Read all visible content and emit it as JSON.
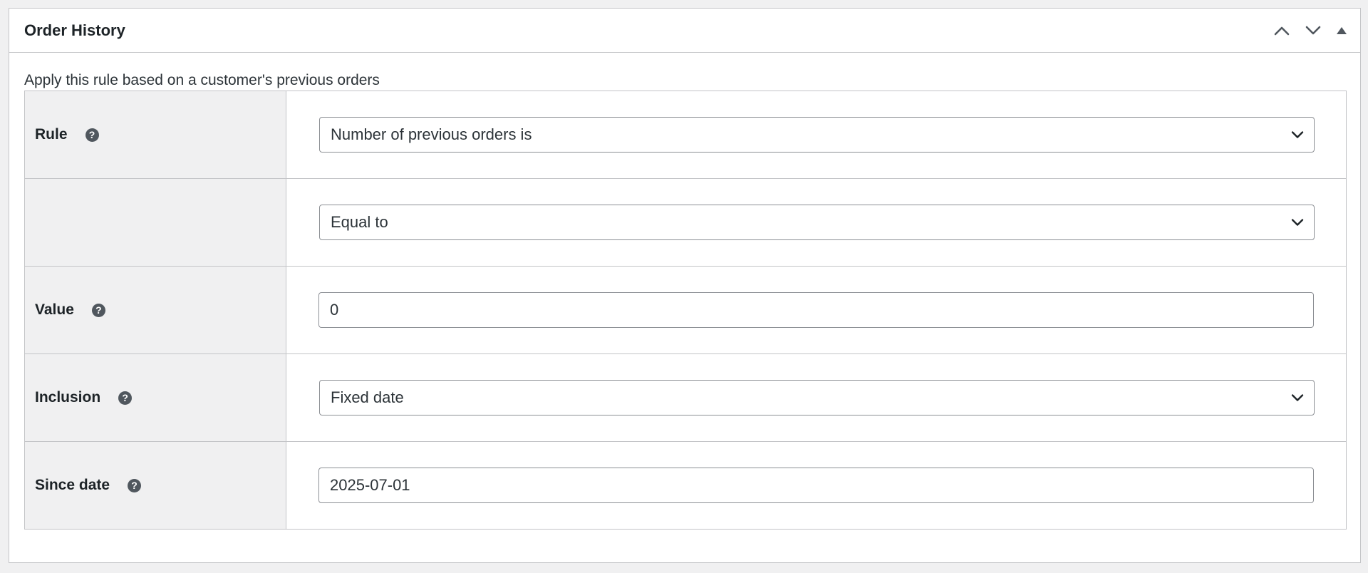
{
  "panel": {
    "title": "Order History",
    "controls": {
      "move_up_icon": "chevron-up-icon",
      "move_down_icon": "chevron-down-icon",
      "toggle_icon": "triangle-up-icon"
    }
  },
  "description": "Apply this rule based on a customer's previous orders",
  "fields": {
    "rule": {
      "label": "Rule",
      "help_icon": "?",
      "selected": "Number of previous orders is"
    },
    "comparison": {
      "label": "",
      "selected": "Equal to"
    },
    "value": {
      "label": "Value",
      "help_icon": "?",
      "value": "0"
    },
    "inclusion": {
      "label": "Inclusion",
      "help_icon": "?",
      "selected": "Fixed date"
    },
    "since_date": {
      "label": "Since date",
      "help_icon": "?",
      "value": "2025-07-01"
    }
  },
  "colors": {
    "background": "#f0f0f1",
    "border": "#c3c4c7",
    "input_border": "#8c8f94",
    "text": "#1d2327",
    "help_icon": "#50575e"
  }
}
